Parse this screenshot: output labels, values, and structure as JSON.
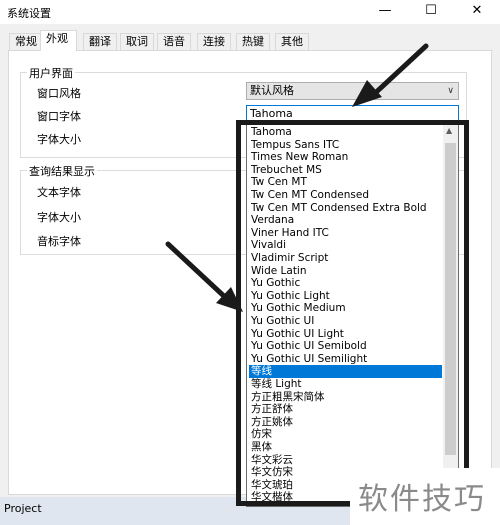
{
  "window": {
    "title": "系统设置",
    "minimize_glyph": "—",
    "maximize_glyph": "☐",
    "close_glyph": "✕"
  },
  "tabs": [
    {
      "label": "常规"
    },
    {
      "label": "外观",
      "active": true
    },
    {
      "label": "翻译"
    },
    {
      "label": "取词"
    },
    {
      "label": "语音"
    },
    {
      "label": "连接"
    },
    {
      "label": "热键"
    },
    {
      "label": "其他"
    }
  ],
  "ui_group": {
    "title": "用户界面",
    "window_style_label": "窗口风格",
    "window_style_value": "默认风格",
    "window_font_label": "窗口字体",
    "window_font_value": "Tahoma",
    "font_size_label": "字体大小"
  },
  "result_group": {
    "title": "查询结果显示",
    "text_font_label": "文本字体",
    "font_size_label": "字体大小",
    "phonetic_font_label": "音标字体"
  },
  "font_list": {
    "items": [
      "Tahoma",
      "Tempus Sans ITC",
      "Times New Roman",
      "Trebuchet MS",
      "Tw Cen MT",
      "Tw Cen MT Condensed",
      "Tw Cen MT Condensed Extra Bold",
      "Verdana",
      "Viner Hand ITC",
      "Vivaldi",
      "Vladimir Script",
      "Wide Latin",
      "Yu Gothic",
      "Yu Gothic Light",
      "Yu Gothic Medium",
      "Yu Gothic UI",
      "Yu Gothic UI Light",
      "Yu Gothic UI Semibold",
      "Yu Gothic UI Semilight",
      "等线",
      "等线 Light",
      "方正粗黑宋简体",
      "方正舒体",
      "方正姚体",
      "仿宋",
      "黑体",
      "华文彩云",
      "华文仿宋",
      "华文琥珀",
      "华文楷体"
    ],
    "selected_index": 19,
    "scroll_up_glyph": "▲"
  },
  "bottom_panel": {
    "label": "Project"
  },
  "watermark": {
    "text": "软件技巧"
  },
  "colors": {
    "selection": "#0078d7",
    "annotation": "#1a1a1a"
  }
}
